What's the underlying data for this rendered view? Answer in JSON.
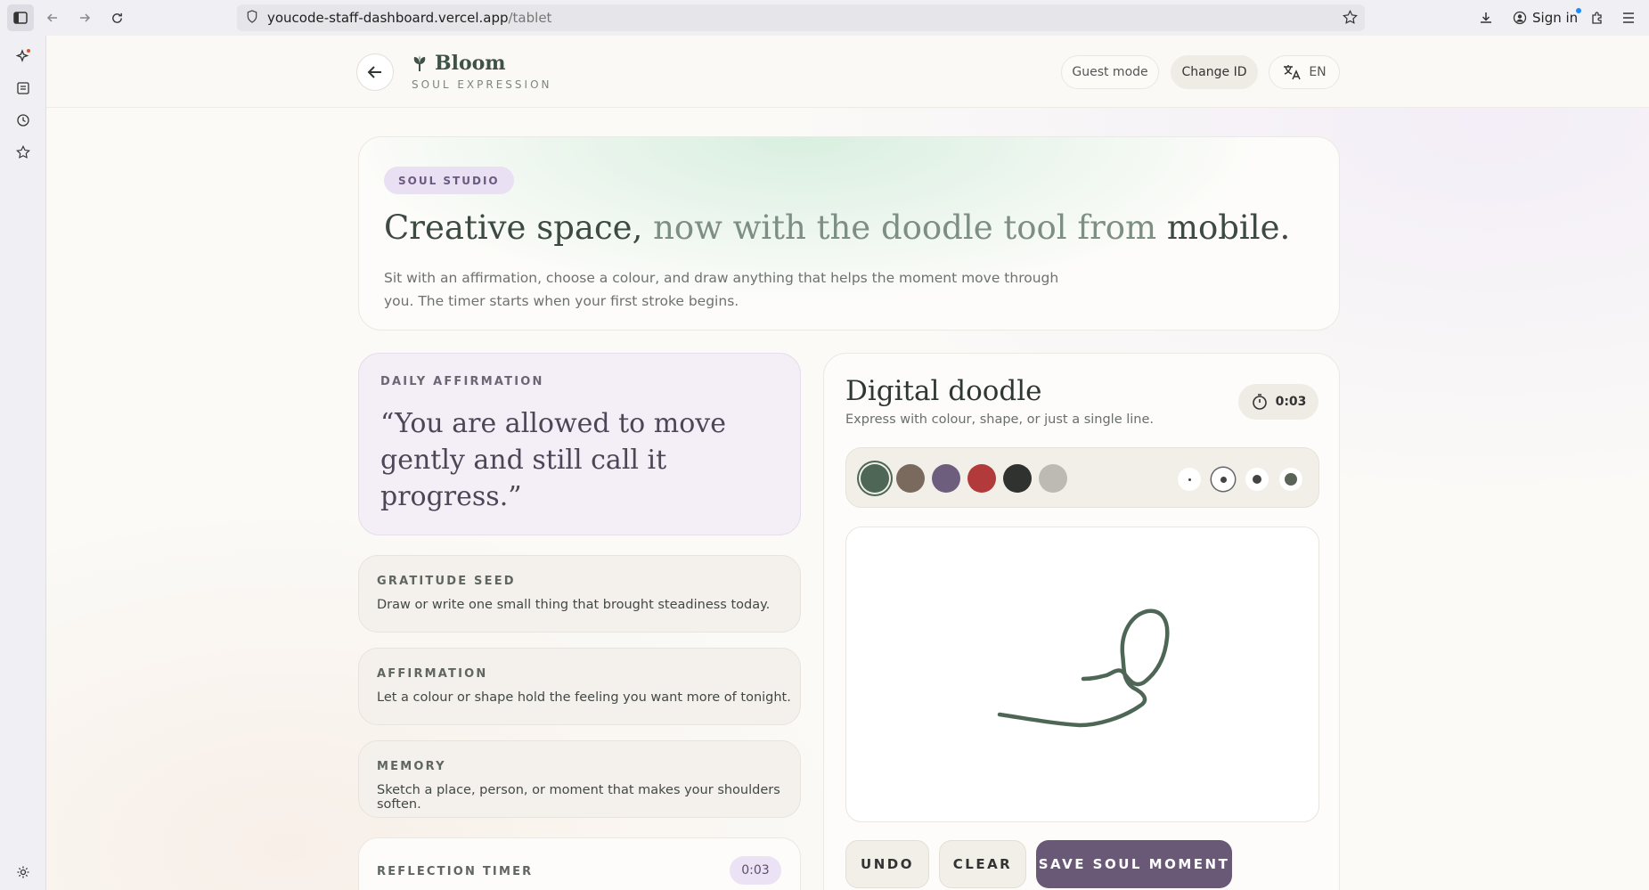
{
  "browser": {
    "url_host": "youcode-staff-dashboard.vercel.app",
    "url_path": "/tablet",
    "sign_in": "Sign in"
  },
  "header": {
    "brand_name": "Bloom",
    "brand_sub": "SOUL EXPRESSION",
    "guest_mode": "Guest mode",
    "change_id": "Change ID",
    "language": "EN"
  },
  "hero": {
    "chip": "SOUL STUDIO",
    "title_main": "Creative space,",
    "title_muted": " now with the doodle tool from ",
    "title_end": "mobile.",
    "description": "Sit with an affirmation, choose a colour, and draw anything that helps the moment move through you. The timer starts when your first stroke begins."
  },
  "affirmation": {
    "label": "DAILY AFFIRMATION",
    "quote": "“You are allowed to move gently and still call it progress.”"
  },
  "prompts": [
    {
      "label": "GRATITUDE SEED",
      "text": "Draw or write one small thing that brought steadiness today."
    },
    {
      "label": "AFFIRMATION",
      "text": "Let a colour or shape hold the feeling you want more of tonight."
    },
    {
      "label": "MEMORY",
      "text": "Sketch a place, person, or moment that makes your shoulders soften."
    }
  ],
  "reflection_timer": {
    "label": "REFLECTION TIMER",
    "value": "0:03"
  },
  "doodle": {
    "title": "Digital doodle",
    "subtitle": "Express with colour, shape, or just a single line.",
    "timer": "0:03",
    "colors": [
      "#4d6656",
      "#7a6a5e",
      "#6d5e7e",
      "#b23a3a",
      "#2f322f",
      "#bdbab4"
    ],
    "selected_color": 0,
    "brush_sizes": [
      3,
      7,
      10,
      14
    ],
    "selected_size": 1,
    "stroke_color": "#4d6656",
    "undo": "UNDO",
    "clear": "CLEAR",
    "save": "SAVE SOUL MOMENT"
  },
  "colors": {
    "accent_dark": "#6a5877",
    "brand_green": "#3f5247",
    "affirmation_bg": "#f4eef7"
  }
}
